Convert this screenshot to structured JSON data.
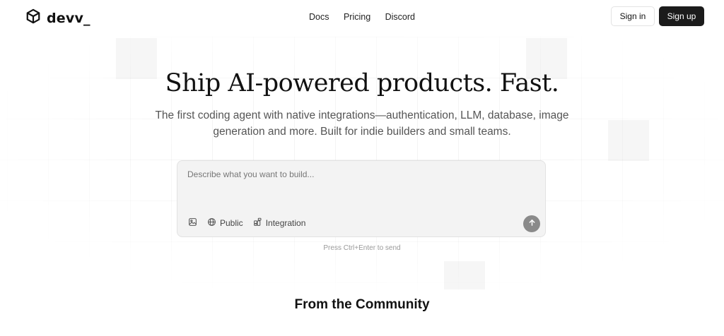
{
  "brand": {
    "name": "devv_"
  },
  "nav": {
    "links": [
      "Docs",
      "Pricing",
      "Discord"
    ],
    "sign_in": "Sign in",
    "sign_up": "Sign up"
  },
  "hero": {
    "title": "Ship AI-powered products. Fast.",
    "subtitle": "The first coding agent with native integrations—authentication, LLM, database, image generation and more. Built for indie builders and small teams."
  },
  "composer": {
    "placeholder": "Describe what you want to build...",
    "tools": [
      {
        "icon": "image-upload-icon",
        "label": ""
      },
      {
        "icon": "globe-icon",
        "label": "Public"
      },
      {
        "icon": "integration-icon",
        "label": "Integration"
      }
    ],
    "send_icon": "arrow-up-icon",
    "hint": "Press Ctrl+Enter to send"
  },
  "section": {
    "community_title": "From the Community"
  },
  "colors": {
    "primary_button": "#1b1b1b",
    "send_button": "#8a8a8a",
    "composer_bg": "#f3f3f3"
  }
}
